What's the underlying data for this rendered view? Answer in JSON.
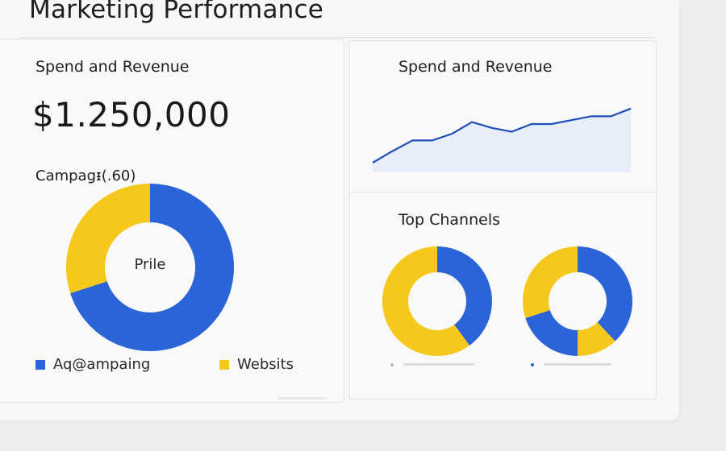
{
  "page": {
    "title": "Marketing Performance"
  },
  "left_panel": {
    "title": "Spend and Revenue",
    "kpi_value": "$1.250,000",
    "campaign_label": "Campagᵻ(.60)",
    "donut": {
      "center_label": "Prile",
      "segments": [
        {
          "name": "Aq@ampaing",
          "value": 70,
          "color": "#2a64d6"
        },
        {
          "name": "Websits",
          "value": 30,
          "color": "#f6c81b"
        }
      ]
    },
    "legend": [
      {
        "label": "Aq@ampaing",
        "color": "#2a64d6"
      },
      {
        "label": "Websits",
        "color": "#f6c81b"
      }
    ]
  },
  "right_top_panel": {
    "title": "Spend and Revenue"
  },
  "right_bottom_panel": {
    "title": "Top Channels",
    "donuts": [
      {
        "segments": [
          {
            "value": 40,
            "color": "#2a64d6"
          },
          {
            "value": 60,
            "color": "#f6c81b"
          }
        ]
      },
      {
        "segments": [
          {
            "value": 38,
            "color": "#2a64d6"
          },
          {
            "value": 12,
            "color": "#f6c81b"
          },
          {
            "value": 20,
            "color": "#2a64d6"
          },
          {
            "value": 30,
            "color": "#f6c81b"
          }
        ]
      }
    ],
    "legend_colors": [
      "#b7b9bf",
      "#2a64d6"
    ]
  },
  "chart_data": {
    "type": "area",
    "title": "Spend and Revenue",
    "x": [
      1,
      2,
      3,
      4,
      5,
      6,
      7,
      8,
      9,
      10,
      11,
      12,
      13,
      14
    ],
    "series": [
      {
        "values": [
          10,
          22,
          33,
          33,
          40,
          52,
          46,
          42,
          50,
          50,
          54,
          58,
          58,
          66
        ]
      }
    ],
    "ylim": [
      0,
      80
    ],
    "color": "#1e4fb8",
    "fill": "#e8eef9"
  }
}
